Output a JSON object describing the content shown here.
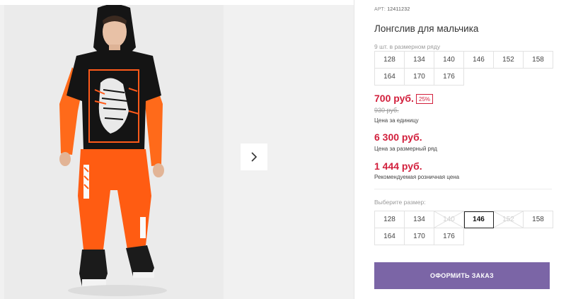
{
  "gallery": {
    "photo_alt": "",
    "next_icon": "chevron-right-icon"
  },
  "product": {
    "article_label": "АРТ:",
    "article_value": "12411232",
    "title": "Лонгслив для мальчика",
    "qty_note": "9 шт. в размерном ряду",
    "size_row": [
      "128",
      "134",
      "140",
      "146",
      "152",
      "158",
      "164",
      "170",
      "176"
    ]
  },
  "prices": {
    "unit_price": "700 руб.",
    "discount": "25%",
    "old_price": "930 руб.",
    "unit_caption": "Цена за единицу",
    "row_price": "6 300 руб.",
    "row_caption": "Цена за размерный ряд",
    "rrp_price": "1 444 руб.",
    "rrp_caption": "Рекомендуемая розничная цена"
  },
  "size_select": {
    "label": "Выберите размер:",
    "sizes": [
      {
        "label": "128",
        "available": true,
        "selected": false
      },
      {
        "label": "134",
        "available": true,
        "selected": false
      },
      {
        "label": "140",
        "available": false,
        "selected": false
      },
      {
        "label": "146",
        "available": true,
        "selected": true
      },
      {
        "label": "152",
        "available": false,
        "selected": false
      },
      {
        "label": "158",
        "available": true,
        "selected": false
      },
      {
        "label": "164",
        "available": true,
        "selected": false
      },
      {
        "label": "170",
        "available": true,
        "selected": false
      },
      {
        "label": "176",
        "available": true,
        "selected": false
      }
    ]
  },
  "actions": {
    "order_label": "ОФОРМИТЬ ЗАКАЗ"
  },
  "colors": {
    "price_red": "#d21f3c",
    "button_purple": "#7b65a6",
    "hoodie_black": "#141414",
    "sleeve_orange": "#ff6a1a"
  }
}
